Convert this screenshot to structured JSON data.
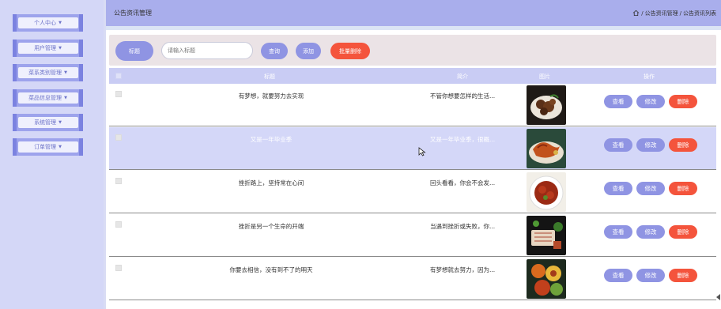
{
  "sidebar": {
    "items": [
      {
        "label": "个人中心"
      },
      {
        "label": "用户管理"
      },
      {
        "label": "菜系类别管理"
      },
      {
        "label": "菜品信息管理"
      },
      {
        "label": "系统管理"
      },
      {
        "label": "订单管理"
      }
    ]
  },
  "header": {
    "title": "公告资讯管理",
    "breadcrumb": [
      "公告资讯管理",
      "公告资讯列表"
    ]
  },
  "search": {
    "label": "标题",
    "placeholder": "请输入标题",
    "query_label": "查询",
    "add_label": "添加",
    "batch_delete_label": "批量删除"
  },
  "table": {
    "columns": [
      "标题",
      "简介",
      "图片",
      "操作"
    ],
    "rows": [
      {
        "title": "有梦想，就要努力去实现",
        "desc": "不管你想要怎样的生活...",
        "image": "food-dish-photo"
      },
      {
        "title": "又是一年毕业季",
        "desc": "又是一年毕业季，很概...",
        "image": "food-dish-photo"
      },
      {
        "title": "挫折路上，坚持常在心间",
        "desc": "回头看看，你会不会发...",
        "image": "food-dish-photo"
      },
      {
        "title": "挫折是另一个生命的开端",
        "desc": "当遇到挫折或失败，你...",
        "image": "food-dish-photo"
      },
      {
        "title": "你要去相信，没有到不了的明天",
        "desc": "有梦想就去努力，因为...",
        "image": "food-dish-photo"
      }
    ],
    "actions": {
      "view": "查看",
      "edit": "修改",
      "delete": "删除"
    }
  },
  "colors": {
    "accent": "#8f94e3",
    "danger": "#f4543c",
    "sidebar_bg": "#d4d7f7",
    "topbar_bg": "#a9aeec"
  }
}
